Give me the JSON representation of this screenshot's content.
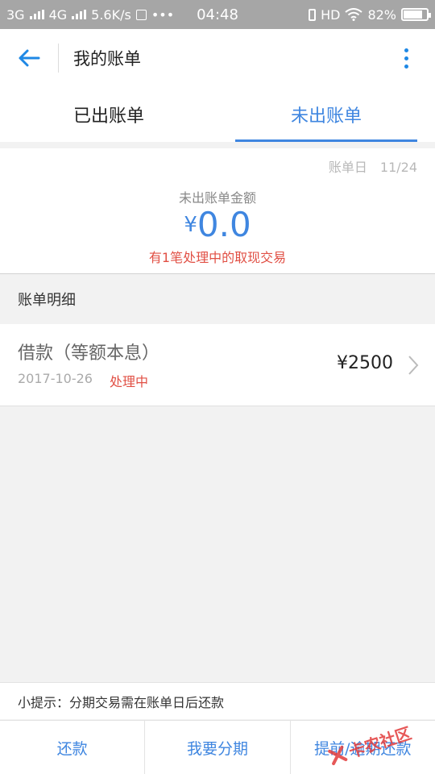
{
  "status_bar": {
    "network_left": "3G",
    "network_right": "4G",
    "speed": "5.6K/s",
    "more": "•••",
    "time": "04:48",
    "hd": "HD",
    "battery": "82%",
    "battery_level": 0.82
  },
  "app_bar": {
    "title": "我的账单"
  },
  "tabs": [
    {
      "label": "已出账单"
    },
    {
      "label": "未出账单"
    }
  ],
  "summary": {
    "bill_date_label": "账单日",
    "bill_date_value": "11/24",
    "label": "未出账单金额",
    "currency": "¥",
    "amount": "0.0",
    "note": "有1笔处理中的取现交易"
  },
  "details": {
    "header": "账单明细",
    "items": [
      {
        "title": "借款（等额本息）",
        "date": "2017-10-26",
        "status": "处理中",
        "amount": "¥2500"
      }
    ]
  },
  "tip": "小提示：分期交易需在账单日后还款",
  "bottom_buttons": [
    {
      "label": "还款"
    },
    {
      "label": "我要分期"
    },
    {
      "label": "提前/逾期还款"
    }
  ],
  "watermark": "卡农社区",
  "colors": {
    "accent": "#3f86e0",
    "alert": "#e15045",
    "status_bar": "#a6a6a6"
  }
}
